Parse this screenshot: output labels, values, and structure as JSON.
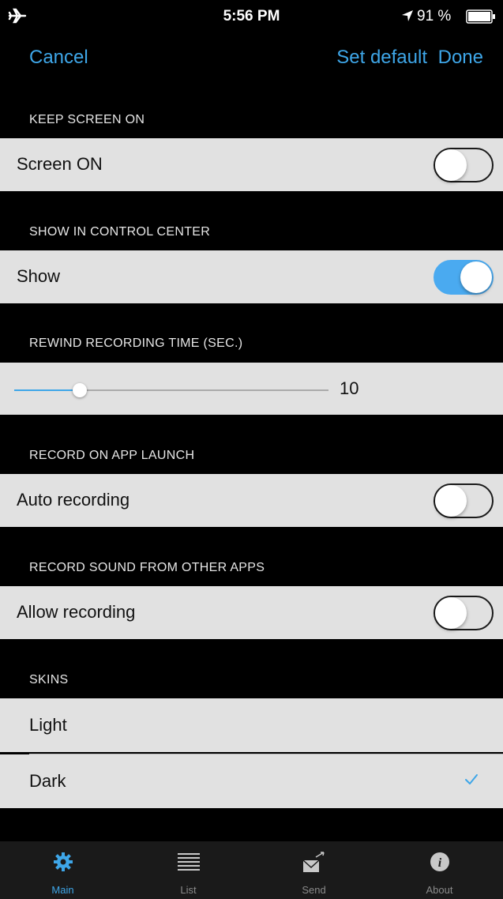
{
  "status_bar": {
    "time": "5:56 PM",
    "battery_text": "91 %"
  },
  "nav": {
    "cancel": "Cancel",
    "set_default": "Set default",
    "done": "Done"
  },
  "sections": {
    "keep_screen": {
      "header": "KEEP SCREEN ON",
      "row_label": "Screen ON",
      "on": false
    },
    "control_center": {
      "header": "SHOW IN CONTROL CENTER",
      "row_label": "Show",
      "on": true
    },
    "rewind": {
      "header": "REWIND RECORDING TIME (SEC.)",
      "value": "10",
      "fraction": 0.2
    },
    "app_launch": {
      "header": "RECORD ON APP LAUNCH",
      "row_label": "Auto recording",
      "on": false
    },
    "other_apps": {
      "header": "RECORD SOUND FROM OTHER APPS",
      "row_label": "Allow recording",
      "on": false
    },
    "skins": {
      "header": "SKINS",
      "options": [
        "Light",
        "Dark"
      ],
      "selected": "Dark"
    }
  },
  "tabs": [
    {
      "label": "Main",
      "icon": "gear-icon",
      "active": true
    },
    {
      "label": "List",
      "icon": "list-icon",
      "active": false
    },
    {
      "label": "Send",
      "icon": "send-mail-icon",
      "active": false
    },
    {
      "label": "About",
      "icon": "info-icon",
      "active": false
    }
  ],
  "colors": {
    "accent": "#3ea6e8",
    "toggle_on": "#4aaaf0",
    "row_bg": "#e1e1e1",
    "background": "#000000"
  }
}
